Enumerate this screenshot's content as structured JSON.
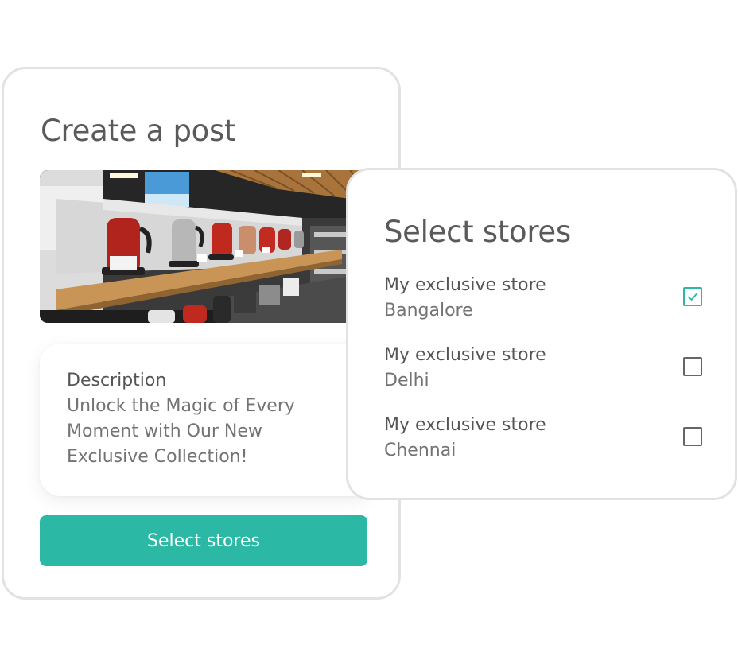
{
  "post": {
    "title": "Create a post",
    "description_label": "Description",
    "description_text": "Unlock the Magic of Every Moment with Our New Exclusive Collection!",
    "select_button_label": "Select stores"
  },
  "stores_panel": {
    "title": "Select stores",
    "stores": [
      {
        "name": "My exclusive store",
        "city": "Bangalore",
        "checked": true
      },
      {
        "name": "My exclusive store",
        "city": "Delhi",
        "checked": false
      },
      {
        "name": "My exclusive store",
        "city": "Chennai",
        "checked": false
      }
    ]
  },
  "colors": {
    "accent": "#2bb9a6",
    "border": "#e2e2e2",
    "text_primary": "#555555",
    "text_secondary": "#737373"
  },
  "icons": {
    "checkmark": "check-icon"
  }
}
